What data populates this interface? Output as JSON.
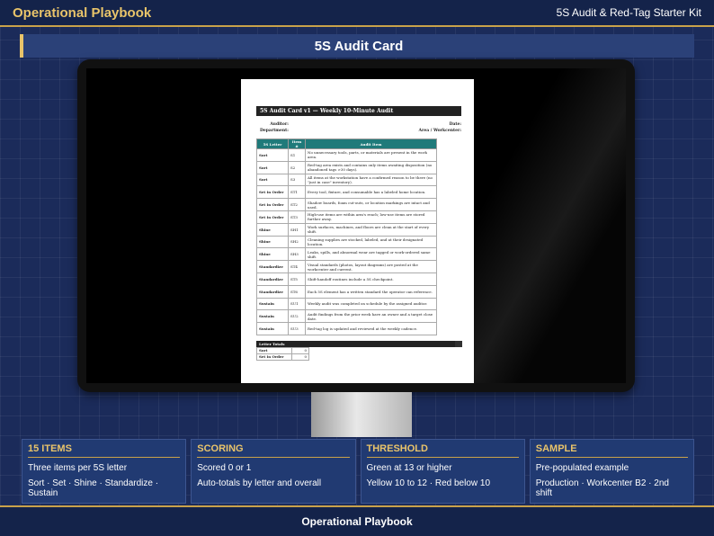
{
  "header": {
    "brand": "Operational Playbook",
    "kit": "5S Audit & Red-Tag Starter Kit"
  },
  "title": "5S Audit Card",
  "document": {
    "heading": "5S Audit Card v1 — Weekly 10-Minute Audit",
    "meta_left": [
      "Auditor:",
      "Department:"
    ],
    "meta_right": [
      "Date:",
      "Area / Workcenter:"
    ],
    "columns": [
      "5S Letter",
      "Item #",
      "Audit Item"
    ],
    "rows": [
      {
        "letter": "Sort",
        "id": "S1",
        "text": "No unnecessary tools, parts, or materials are present in the work area."
      },
      {
        "letter": "Sort",
        "id": "S2",
        "text": "Red-tag area exists and contains only items awaiting disposition (no abandoned tags >30 days)."
      },
      {
        "letter": "Sort",
        "id": "S3",
        "text": "All items at the workstation have a confirmed reason to be there (no \"just in case\" inventory)."
      },
      {
        "letter": "Set in Order",
        "id": "ST1",
        "text": "Every tool, fixture, and consumable has a labeled home location."
      },
      {
        "letter": "Set in Order",
        "id": "ST2",
        "text": "Shadow boards, foam cut-outs, or location markings are intact and used."
      },
      {
        "letter": "Set in Order",
        "id": "ST3",
        "text": "High-use items are within arm's reach; low-use items are stored further away."
      },
      {
        "letter": "Shine",
        "id": "SH1",
        "text": "Work surfaces, machines, and floors are clean at the start of every shift."
      },
      {
        "letter": "Shine",
        "id": "SH2",
        "text": "Cleaning supplies are stocked, labeled, and at their designated location."
      },
      {
        "letter": "Shine",
        "id": "SH3",
        "text": "Leaks, spills, and abnormal wear are tagged or work-ordered same shift."
      },
      {
        "letter": "Standardize",
        "id": "ST4",
        "text": "Visual standards (photos, layout diagrams) are posted at the workcenter and current."
      },
      {
        "letter": "Standardize",
        "id": "ST5",
        "text": "Shift-handoff routines include a 5S checkpoint."
      },
      {
        "letter": "Standardize",
        "id": "ST6",
        "text": "Each 5S element has a written standard the operator can reference."
      },
      {
        "letter": "Sustain",
        "id": "SU1",
        "text": "Weekly audit was completed on schedule by the assigned auditor."
      },
      {
        "letter": "Sustain",
        "id": "SU2",
        "text": "Audit findings from the prior week have an owner and a target close date."
      },
      {
        "letter": "Sustain",
        "id": "SU3",
        "text": "Red-tag log is updated and reviewed at the weekly cadence."
      }
    ],
    "totals_heading": "Letter Totals",
    "totals": [
      {
        "label": "Sort",
        "value": "0"
      },
      {
        "label": "Set in Order",
        "value": "0"
      }
    ]
  },
  "cards": [
    {
      "title": "15 ITEMS",
      "lines": [
        "Three items per 5S letter",
        "Sort · Set · Shine · Standardize · Sustain"
      ]
    },
    {
      "title": "SCORING",
      "lines": [
        "Scored 0 or 1",
        "Auto-totals by letter and overall"
      ]
    },
    {
      "title": "THRESHOLD",
      "lines": [
        "Green at 13 or higher",
        "Yellow 10 to 12 · Red below 10"
      ]
    },
    {
      "title": "SAMPLE",
      "lines": [
        "Pre-populated example",
        "Production · Workcenter B2 · 2nd shift"
      ]
    }
  ],
  "footer": "Operational Playbook"
}
